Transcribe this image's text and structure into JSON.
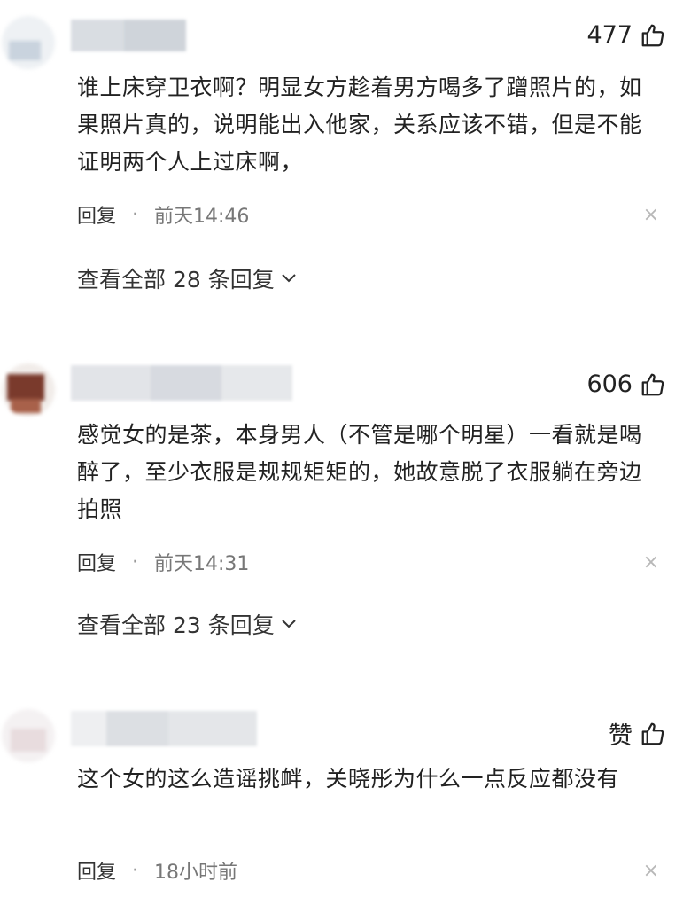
{
  "comments": [
    {
      "likes": "477",
      "text": "谁上床穿卫衣啊？明显女方趁着男方喝多了蹭照片的，如果照片真的，说明能出入他家，关系应该不错，但是不能证明两个人上过床啊，",
      "reply_label": "回复",
      "separator": "·",
      "time": "前天14:46",
      "close_glyph": "×",
      "view_all": "查看全部 28 条回复"
    },
    {
      "likes": "606",
      "text": "感觉女的是茶，本身男人（不管是哪个明星）一看就是喝醉了，至少衣服是规规矩矩的，她故意脱了衣服躺在旁边拍照",
      "reply_label": "回复",
      "separator": "·",
      "time": "前天14:31",
      "close_glyph": "×",
      "view_all": "查看全部 23 条回复"
    },
    {
      "likes": "赞",
      "text": "这个女的这么造谣挑衅，关晓彤为什么一点反应都没有",
      "reply_label": "回复",
      "separator": "·",
      "time": "18小时前",
      "close_glyph": "×"
    }
  ],
  "icons": {
    "like": "thumbs-up-icon",
    "expand": "chevron-down-icon",
    "close": "close-icon"
  },
  "colors": {
    "text": "#222222",
    "muted": "#777777",
    "close": "#b8b8b8"
  }
}
